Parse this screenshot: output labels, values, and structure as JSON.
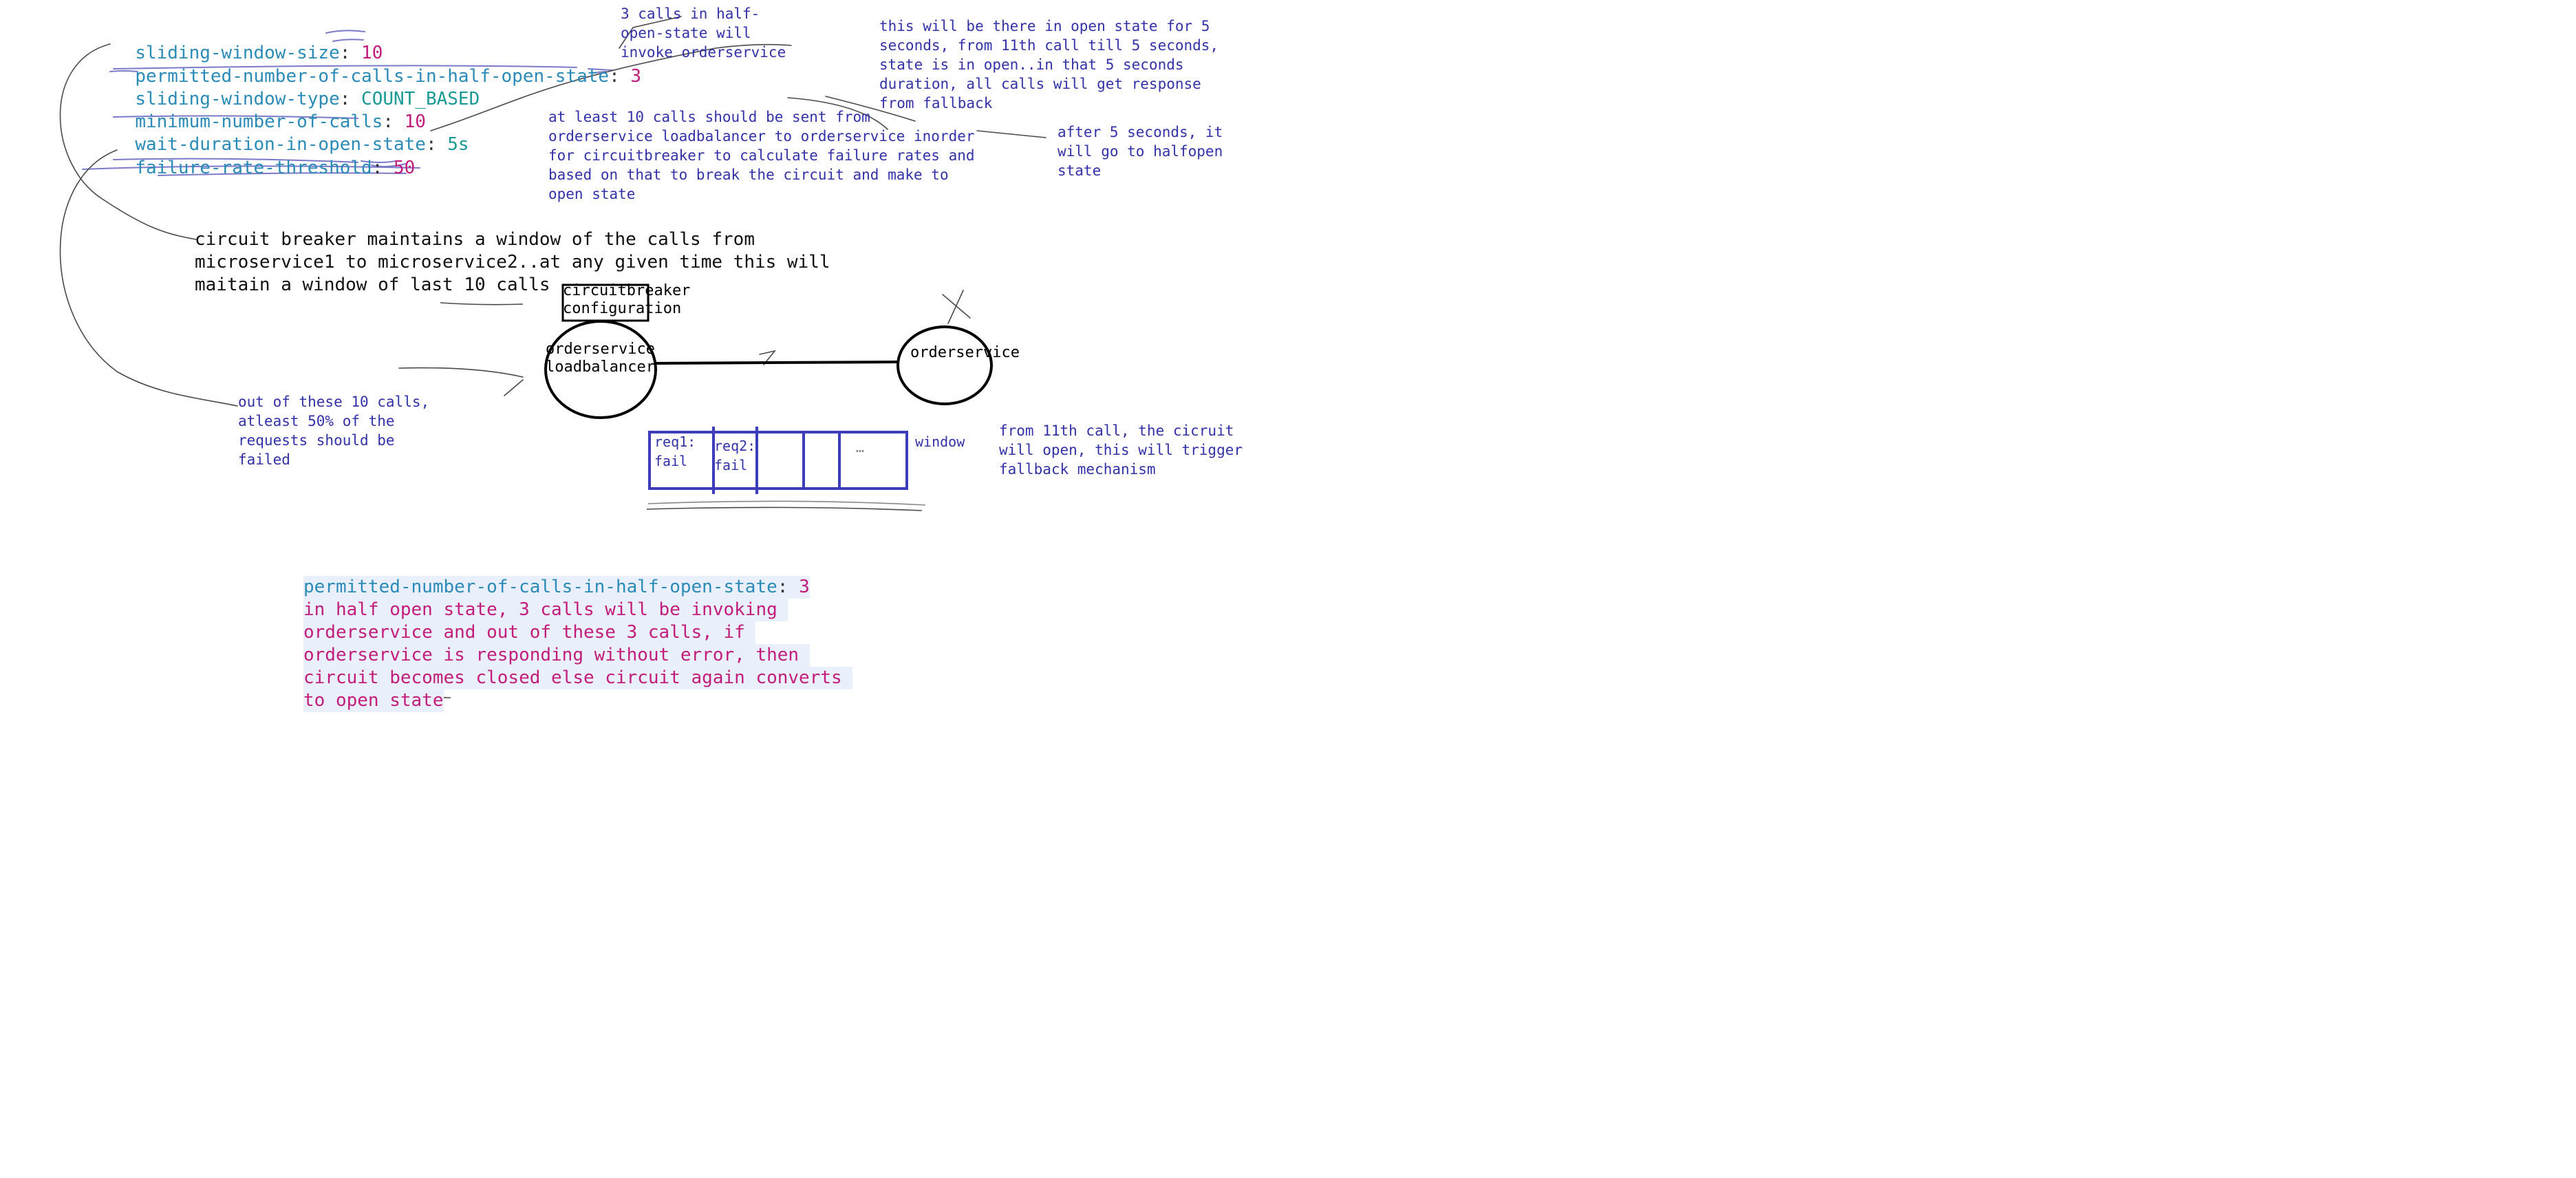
{
  "config": [
    {
      "key": "sliding-window-size",
      "value": "10"
    },
    {
      "key": "permitted-number-of-calls-in-half-open-state",
      "value": "3"
    },
    {
      "key": "sliding-window-type",
      "value": "COUNT_BASED"
    },
    {
      "key": "minimum-number-of-calls",
      "value": "10"
    },
    {
      "key": "wait-duration-in-open-state",
      "value": "5s"
    },
    {
      "key": "failure-rate-threshold",
      "value": "50"
    }
  ],
  "separator": ": ",
  "notes": {
    "half_open_calls": "3 calls in half-\nopen-state will\ninvoke orderservice",
    "open_state_duration": "this will be there in open state for 5\nseconds, from 11th call till 5 seconds,\nstate is in open..in that 5 seconds\nduration, all calls will get response\nfrom fallback",
    "min_calls": "at least 10 calls should be sent from\norderservice loadbalancer to orderservice inorder\nfor circuitbreaker to calculate failure rates and\nbased on that to break the circuit and make to\nopen state",
    "after_wait": "after 5 seconds, it\nwill go to halfopen\nstate",
    "failure_rate": "out of these 10 calls,\natleast 50% of the\nrequests should be\nfailed",
    "from_11th": "from 11th call, the cicruit\nwill open, this will trigger\nfallback mechanism"
  },
  "main_text": "circuit breaker maintains a window of the calls from\nmicroservice1 to microservice2..at any given time this will\nmaitain a window of last 10 calls",
  "diagram": {
    "cb_config_label": "circuitbreaker\nconfiguration",
    "loadbalancer_label": "orderservice\nloadbalancer",
    "orderservice_label": "orderservice",
    "window_label": "window",
    "cells": [
      "req1:\nfail",
      "req2:\nfail",
      "",
      "",
      "…"
    ]
  },
  "half_open_box": {
    "key": "permitted-number-of-calls-in-half-open-state",
    "value": "3",
    "lines": [
      "in half open state, 3 calls will be invoking ",
      "orderservice and out of these 3 calls, if ",
      "orderservice is responding without error, then ",
      "circuit becomes closed else circuit again converts ",
      "to open state"
    ]
  },
  "colors": {
    "key": "#2b8bb8",
    "value": "#c21d7c",
    "value_text": "#1a9a96",
    "note_ink": "#3232a8",
    "highlight": "#e9f0fb"
  }
}
